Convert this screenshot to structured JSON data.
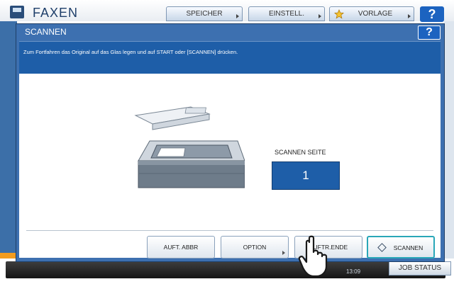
{
  "background": {
    "title": "FAXEN",
    "buttons": [
      "SPEICHER",
      "EINSTELL.",
      "VORLAGE"
    ],
    "help": "?",
    "time": "13:09",
    "job_status": "JOB STATUS"
  },
  "dialog": {
    "title": "SCANNEN",
    "help": "?",
    "message": "Zum Fortfahren das Original auf das Glas legen und auf START oder [SCANNEN] drücken.",
    "scan_page_label": "SCANNEN SEITE",
    "scan_page_value": "1",
    "buttons": {
      "cancel": "AUFT. ABBR",
      "option": "OPTION",
      "finish": "AUFTR.ENDE",
      "scan": "SCANNEN"
    }
  },
  "colors": {
    "accent_blue": "#1e5ea8",
    "dialog_blue": "#3d70b0",
    "scan_button_border": "#29a7b8"
  },
  "icons": [
    "fax-icon",
    "star-icon",
    "help-icon",
    "scanner-illustration",
    "scan-start-icon",
    "pointer-hand-icon"
  ]
}
